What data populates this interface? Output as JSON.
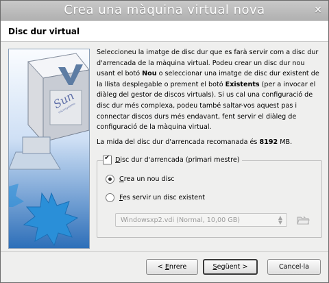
{
  "window": {
    "title": "Crea una màquina virtual nova",
    "close_glyph": "✕"
  },
  "header": {
    "title": "Disc dur virtual"
  },
  "sidebar": {
    "logo_text": "Sun",
    "logo_subtext": "microsystems"
  },
  "description": {
    "p1_a": "Seleccioneu la imatge de disc dur que es farà servir com a disc dur d'arrencada de la màquina virtual. Podeu crear un disc dur nou usant el botó ",
    "p1_new": "Nou",
    "p1_b": " o seleccionar una imatge de disc dur existent de la llista desplegable o prement el botó ",
    "p1_existing": "Existents",
    "p1_c": " (per a invocar el diàleg del gestor de discos virtuals). Si us cal una configuració de disc dur més complexa, podeu també saltar-vos aquest pas i connectar discos durs més endavant, fent servir el diàleg de configuració de la màquina virtual.",
    "p2_a": "La mida del disc dur d'arrencada recomanada és ",
    "p2_size": "8192",
    "p2_unit": " MB."
  },
  "boot_disk": {
    "checkbox_label_first": "D",
    "checkbox_label_rest": "isc dur d'arrencada (primari mestre)",
    "checked": true,
    "radio_new_first": "C",
    "radio_new_rest": "rea un nou disc",
    "radio_existing_first": "F",
    "radio_existing_rest": "es servir un disc existent",
    "selected": "new",
    "disk_select_value": "Windowsxp2.vdi (Normal, 10,00 GB)"
  },
  "buttons": {
    "back_prefix": "< ",
    "back_accel": "E",
    "back_rest": "nrere",
    "next_accel": "S",
    "next_rest": "egüent >",
    "cancel": "Cancel·la"
  },
  "icons": {
    "close": "close-icon",
    "folder": "folder-icon",
    "combo_arrows": "updown-arrows-icon"
  },
  "colors": {
    "title_text": "#ffffff",
    "sidebar_blue": "#2d6fb9",
    "starburst": "#2a8fd8"
  }
}
